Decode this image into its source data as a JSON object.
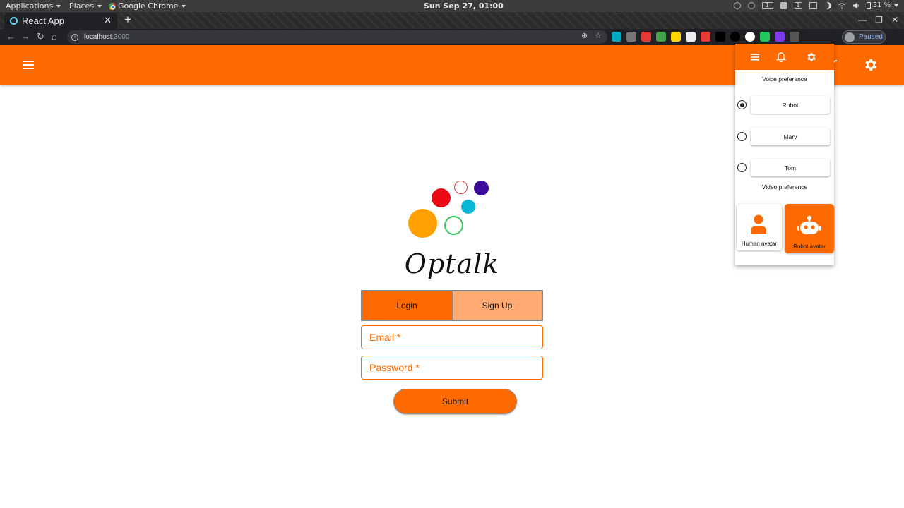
{
  "os": {
    "menus": [
      "Applications",
      "Places",
      "Google Chrome"
    ],
    "clock": "Sun Sep 27, 01:00",
    "workspace": "1",
    "battery": "31 %"
  },
  "browser": {
    "tab_title": "React App",
    "url_host": "localhost",
    "url_port": ":3000",
    "profile_status": "Paused",
    "extension_colors": [
      "#00a9c0",
      "#777",
      "#e53935",
      "#43a047",
      "#ffd600",
      "#eee",
      "#e53935",
      "#000",
      "#000",
      "#fff",
      "#22c55e",
      "#7c3aed",
      "#555"
    ]
  },
  "app": {
    "accent": "#ff6a00",
    "brand": {
      "name": "Optalk"
    },
    "auth_tabs": {
      "login": "Login",
      "signup": "Sign Up"
    },
    "fields": {
      "email": "Email *",
      "password": "Password *"
    },
    "submit_label": "Submit"
  },
  "settings_popup": {
    "voice_title": "Voice preference",
    "voice_options": [
      {
        "label": "Robot",
        "selected": true
      },
      {
        "label": "Mary",
        "selected": false
      },
      {
        "label": "Tom",
        "selected": false
      }
    ],
    "video_title": "Video preference",
    "video_options": [
      {
        "label": "Human avatar",
        "selected": false
      },
      {
        "label": "Robot avatar",
        "selected": true
      }
    ]
  }
}
